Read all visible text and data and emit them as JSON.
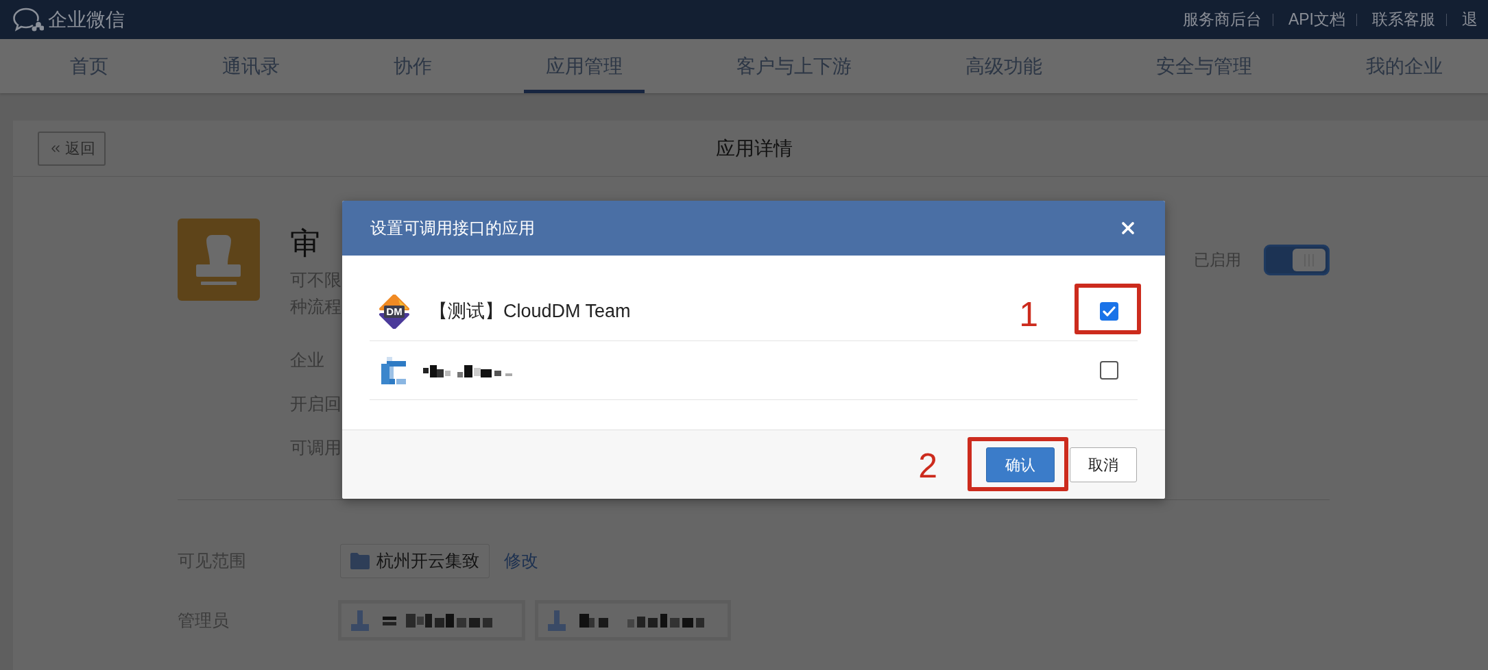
{
  "topbar": {
    "brand": "企业微信",
    "links": [
      "服务商后台",
      "API文档",
      "联系客服",
      "退"
    ]
  },
  "nav": [
    {
      "label": "首页",
      "selected": false
    },
    {
      "label": "通讯录",
      "selected": false
    },
    {
      "label": "协作",
      "selected": false
    },
    {
      "label": "应用管理",
      "selected": true
    },
    {
      "label": "客户与上下游",
      "selected": false
    },
    {
      "label": "高级功能",
      "selected": false
    },
    {
      "label": "安全与管理",
      "selected": false
    },
    {
      "label": "我的企业",
      "selected": false
    }
  ],
  "page": {
    "back": "返回",
    "title": "应用详情"
  },
  "app": {
    "name": "审",
    "description": [
      "可不限",
      "种流程"
    ],
    "details": [
      "企业",
      "开启回",
      "可调用"
    ],
    "status": "已启用",
    "enabled": true
  },
  "visibility": {
    "label": "可见范围",
    "scope": "杭州开云集致",
    "edit": "修改"
  },
  "admins": {
    "label": "管理员",
    "items": [
      {
        "kind": "pixelated"
      },
      {
        "kind": "pixelated"
      }
    ]
  },
  "dialog": {
    "title": "设置可调用接口的应用",
    "options": [
      {
        "kind": "app",
        "logo": "DM",
        "name": "【测试】CloudDM Team",
        "checked": true,
        "annotation": "1"
      },
      {
        "kind": "pixelated",
        "checked": false
      }
    ],
    "buttons": [
      {
        "label": "确认",
        "kind": "primary",
        "annotation": "2"
      },
      {
        "label": "取消",
        "kind": "secondary"
      }
    ]
  }
}
